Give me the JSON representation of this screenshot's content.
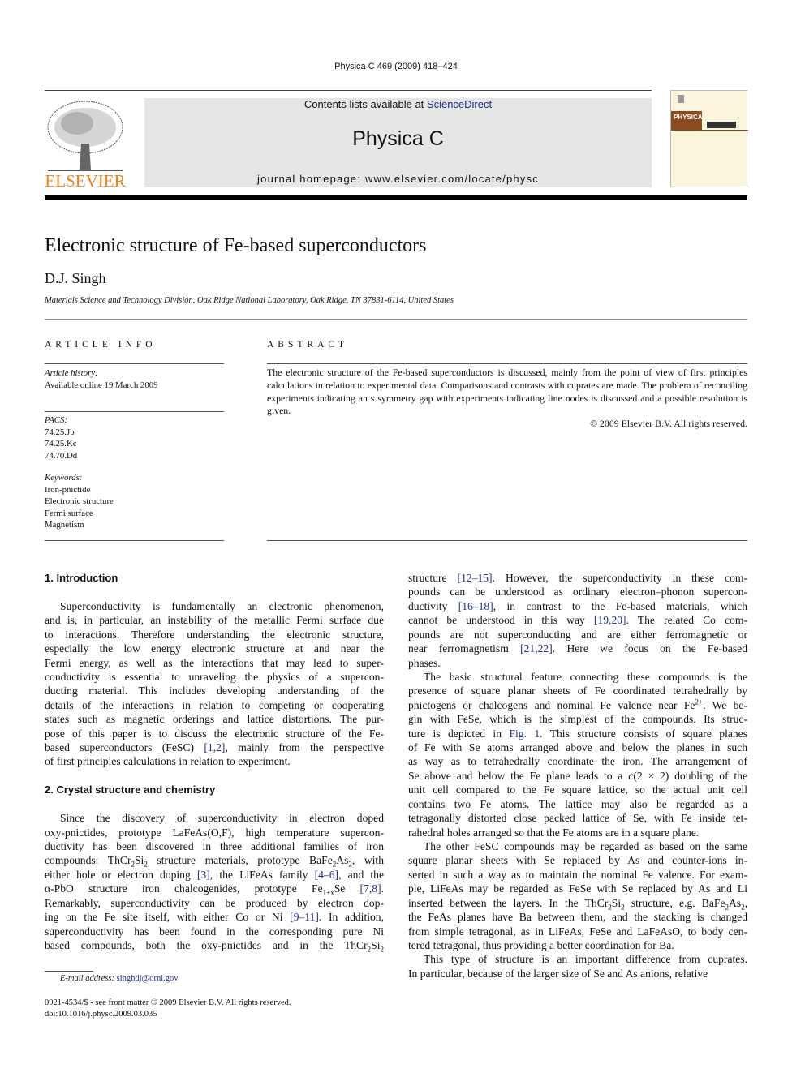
{
  "journal_header": {
    "citation": "Physica C  469 (2009) 418–424",
    "contents_prefix": "Contents lists available at ",
    "contents_link": "ScienceDirect",
    "journal_name": "Physica C",
    "homepage": "journal homepage: www.elsevier.com/locate/physc",
    "publisher": "ELSEVIER",
    "cover_title": "PHYSICA",
    "brand_color": "#f07f1e"
  },
  "article": {
    "title": "Electronic structure of Fe-based superconductors",
    "author": "D.J. Singh",
    "affiliation": "Materials Science and Technology Division, Oak Ridge National Laboratory, Oak Ridge, TN 37831-6114, United States"
  },
  "article_info": {
    "heading": "ARTICLE INFO",
    "history_label": "Article history:",
    "history": "Available online 19 March 2009",
    "pacs_label": "PACS:",
    "pacs": [
      "74.25.Jb",
      "74.25.Kc",
      "74.70.Dd"
    ],
    "keywords_label": "Keywords:",
    "keywords": [
      "Iron-pnictide",
      "Electronic structure",
      "Fermi surface",
      "Magnetism"
    ]
  },
  "abstract": {
    "heading": "ABSTRACT",
    "text": "The electronic structure of the Fe-based superconductors is discussed, mainly from the point of view of first principles calculations in relation to experimental data. Comparisons and contrasts with cuprates are made. The problem of reconciling experiments indicating an s symmetry gap with experiments indicating line nodes is discussed and a possible resolution is given.",
    "copyright": "© 2009 Elsevier B.V. All rights reserved."
  },
  "sections": [
    {
      "heading": "1. Introduction",
      "paragraphs": [
        [
          [
            "Superconductivity is fundamentally an electronic phenomenon,"
          ],
          [
            "and is, in particular, an instability of the metallic Fermi surface due"
          ],
          [
            "to interactions. Therefore understanding the electronic structure,"
          ],
          [
            "especially the low energy electronic structure at and near the"
          ],
          [
            "Fermi energy, as well as the interactions that may lead to super-"
          ],
          [
            "conductivity is essential to unraveling the physics of a supercon-"
          ],
          [
            "ducting material. This includes developing understanding of the"
          ],
          [
            "details of the interactions in relation to competing or cooperating"
          ],
          [
            "states such as magnetic orderings and lattice distortions. The pur-"
          ],
          [
            "pose of this paper is to discuss the electronic structure of the Fe-"
          ],
          [
            "based superconductors (FeSC) ",
            {
              "ref": "[1,2]"
            },
            ", mainly from the perspective"
          ],
          [
            "of first principles calculations in relation to experiment."
          ]
        ]
      ]
    },
    {
      "heading": "2. Crystal structure and chemistry",
      "paragraphs": [
        [
          [
            "Since the discovery of superconductivity in electron doped"
          ],
          [
            "oxy-pnictides, prototype LaFeAs(O,F), high temperature supercon-"
          ],
          [
            "ductivity has been discovered in three additional families of iron"
          ],
          [
            "compounds: ThCr",
            {
              "sub": "2"
            },
            "Si",
            {
              "sub": "2"
            },
            " structure materials, prototype BaFe",
            {
              "sub": "2"
            },
            "As",
            {
              "sub": "2"
            },
            ", with"
          ],
          [
            "either hole or electron doping ",
            {
              "ref": "[3]"
            },
            ", the LiFeAs family ",
            {
              "ref": "[4–6]"
            },
            ", and the"
          ],
          [
            "α-PbO structure iron chalcogenides, prototype Fe",
            {
              "sub": "1+x"
            },
            "Se ",
            {
              "ref": "[7,8]"
            },
            "."
          ],
          [
            "Remarkably, superconductivity can be produced by electron dop-"
          ],
          [
            "ing on the Fe site itself, with either Co or Ni ",
            {
              "ref": "[9–11]"
            },
            ". In addition,"
          ],
          [
            "superconductivity has been found in the corresponding pure Ni"
          ],
          [
            "based compounds, both the oxy-pnictides and in the ThCr",
            {
              "sub": "2"
            },
            "Si",
            {
              "sub": "2"
            }
          ]
        ]
      ]
    },
    {
      "heading": "",
      "paragraphs": [
        [
          [
            "structure ",
            {
              "ref": "[12–15]"
            },
            ". However, the superconductivity in these com-"
          ],
          [
            "pounds can be understood as ordinary electron–phonon supercon-"
          ],
          [
            "ductivity ",
            {
              "ref": "[16–18]"
            },
            ", in contrast to the Fe-based materials, which"
          ],
          [
            "cannot be understood in this way ",
            {
              "ref": "[19,20]"
            },
            ". The related Co com-"
          ],
          [
            "pounds are not superconducting and are either ferromagnetic or"
          ],
          [
            "near ferromagnetism ",
            {
              "ref": "[21,22]"
            },
            ". Here we focus on the Fe-based"
          ],
          [
            "phases."
          ]
        ],
        [
          [
            "The basic structural feature connecting these compounds is the"
          ],
          [
            "presence of square planar sheets of Fe coordinated tetrahedrally by"
          ],
          [
            "pnictogens or chalcogens and nominal Fe valence near Fe",
            {
              "sup": "2+"
            },
            ". We be-"
          ],
          [
            "gin with FeSe, which is the simplest of the compounds. Its struc-"
          ],
          [
            "ture is depicted in ",
            {
              "ref": "Fig. 1"
            },
            ". This structure consists of square planes"
          ],
          [
            "of Fe with Se atoms arranged above and below the planes in such"
          ],
          [
            "as way as to tetrahedrally coordinate the iron. The arrangement of"
          ],
          [
            "Se above and below the Fe plane leads to a ",
            {
              "i": "c"
            },
            "(2 × 2) doubling of the"
          ],
          [
            "unit cell compared to the Fe square lattice, so the actual unit cell"
          ],
          [
            "contains two Fe atoms. The lattice may also be regarded as a"
          ],
          [
            "tetragonally distorted close packed lattice of Se, with Fe inside tet-"
          ],
          [
            "rahedral holes arranged so that the Fe atoms are in a square plane."
          ]
        ],
        [
          [
            "The other FeSC compounds may be regarded as based on the same"
          ],
          [
            "square planar sheets with Se replaced by As and counter-ions in-"
          ],
          [
            "serted in such a way as to maintain the nominal Fe valence. For exam-"
          ],
          [
            "ple, LiFeAs may be regarded as FeSe with Se replaced by As and Li"
          ],
          [
            "inserted between the layers. In the ThCr",
            {
              "sub": "2"
            },
            "Si",
            {
              "sub": "2"
            },
            " structure, e.g. BaFe",
            {
              "sub": "2"
            },
            "As",
            {
              "sub": "2"
            },
            ","
          ],
          [
            "the FeAs planes have Ba between them, and the stacking is changed"
          ],
          [
            "from simple tetragonal, as in LiFeAs, FeSe and LaFeAsO, to body cen-"
          ],
          [
            "tered tetragonal, thus providing a better coordination for Ba."
          ]
        ],
        [
          [
            "This type of structure is an important difference from cuprates."
          ],
          [
            "In particular, because of the larger size of Se and As anions, relative"
          ]
        ]
      ]
    }
  ],
  "footnote": {
    "email_label": "E-mail address: ",
    "email": "singhdj@ornl.gov"
  },
  "footer": {
    "issn": "0921-4534/$ - see front matter © 2009 Elsevier B.V. All rights reserved.",
    "doi": "doi:10.1016/j.physc.2009.03.035"
  }
}
